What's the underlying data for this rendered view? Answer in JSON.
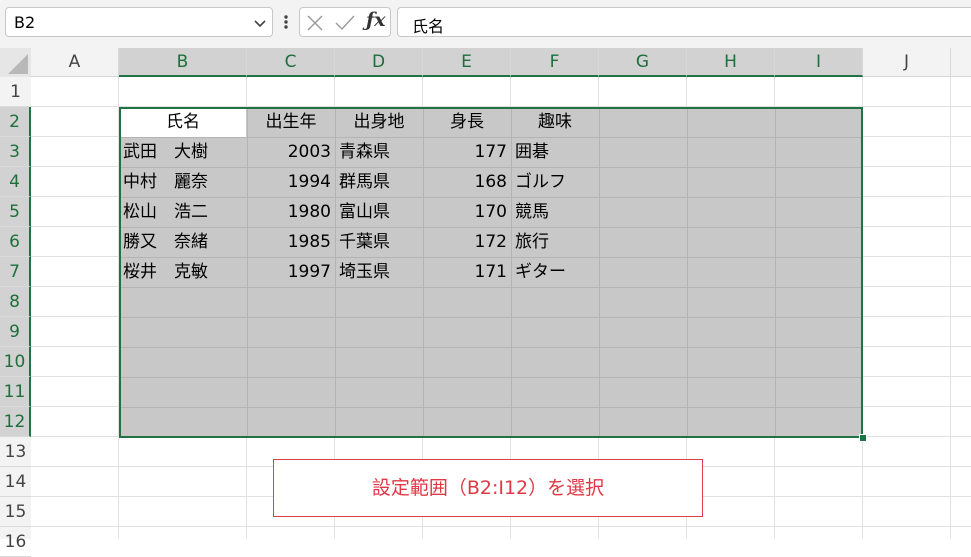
{
  "name_box": {
    "value": "B2"
  },
  "formula_bar": {
    "value": "氏名"
  },
  "columns": [
    "A",
    "B",
    "C",
    "D",
    "E",
    "F",
    "G",
    "H",
    "I",
    "J"
  ],
  "rows": [
    "1",
    "2",
    "3",
    "4",
    "5",
    "6",
    "7",
    "8",
    "9",
    "10",
    "11",
    "12",
    "13",
    "14",
    "15",
    "16"
  ],
  "table": {
    "headers": [
      "氏名",
      "出生年",
      "出身地",
      "身長",
      "趣味"
    ],
    "records": [
      [
        "武田　大樹",
        "2003",
        "青森県",
        "177",
        "囲碁"
      ],
      [
        "中村　麗奈",
        "1994",
        "群馬県",
        "168",
        "ゴルフ"
      ],
      [
        "松山　浩二",
        "1980",
        "富山県",
        "170",
        "競馬"
      ],
      [
        "勝又　奈緒",
        "1985",
        "千葉県",
        "172",
        "旅行"
      ],
      [
        "桜井　克敏",
        "1997",
        "埼玉県",
        "171",
        "ギター"
      ]
    ]
  },
  "callout": {
    "text": "設定範囲（B2:I12）を選択"
  },
  "colors": {
    "accent": "#217346",
    "selection": "#c8c8c8",
    "callout": "#e03844"
  }
}
